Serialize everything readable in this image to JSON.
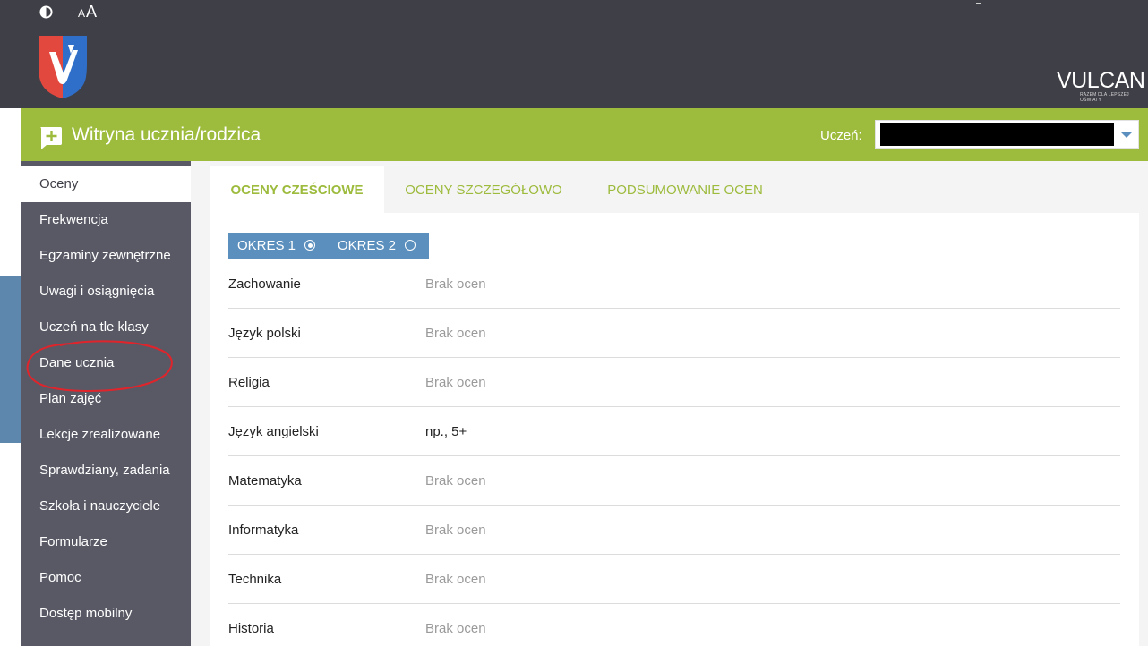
{
  "header": {
    "font_size_small": "A",
    "font_size_large": "A",
    "brand_word": "VULCAN",
    "brand_tagline": "RAZEM DLA LEPSZEJ OŚWIATY"
  },
  "app": {
    "title": "Witryna ucznia/rodzica",
    "student_label": "Uczeń:"
  },
  "sidebar": {
    "items": [
      {
        "label": "Oceny",
        "active": true
      },
      {
        "label": "Frekwencja"
      },
      {
        "label": "Egzaminy zewnętrzne"
      },
      {
        "label": "Uwagi i osiągnięcia"
      },
      {
        "label": "Uczeń na tle klasy"
      },
      {
        "label": "Dane ucznia"
      },
      {
        "label": "Plan zajęć"
      },
      {
        "label": "Lekcje zrealizowane"
      },
      {
        "label": "Sprawdziany, zadania"
      },
      {
        "label": "Szkoła i nauczyciele"
      },
      {
        "label": "Formularze"
      },
      {
        "label": "Pomoc"
      },
      {
        "label": "Dostęp mobilny"
      }
    ]
  },
  "tabs": [
    {
      "label": "OCENY CZEŚCIOWE",
      "active": true
    },
    {
      "label": "OCENY SZCZEGÓŁOWO"
    },
    {
      "label": "PODSUMOWANIE OCEN"
    }
  ],
  "periods": [
    {
      "label": "OKRES 1",
      "selected": true
    },
    {
      "label": "OKRES 2",
      "selected": false
    }
  ],
  "grades": [
    {
      "subject": "Zachowanie",
      "value": "Brak ocen"
    },
    {
      "subject": "Język polski",
      "value": "Brak ocen"
    },
    {
      "subject": "Religia",
      "value": "Brak ocen"
    },
    {
      "subject": "Język angielski",
      "value": "np., 5+"
    },
    {
      "subject": "Matematyka",
      "value": "Brak ocen"
    },
    {
      "subject": "Informatyka",
      "value": "Brak ocen"
    },
    {
      "subject": "Technika",
      "value": "Brak ocen"
    },
    {
      "subject": "Historia",
      "value": "Brak ocen"
    }
  ],
  "colors": {
    "header_bg": "#3f3f48",
    "accent_green": "#9dbb3d",
    "sidebar_bg": "#595966",
    "period_blue": "#5b8fbd"
  }
}
